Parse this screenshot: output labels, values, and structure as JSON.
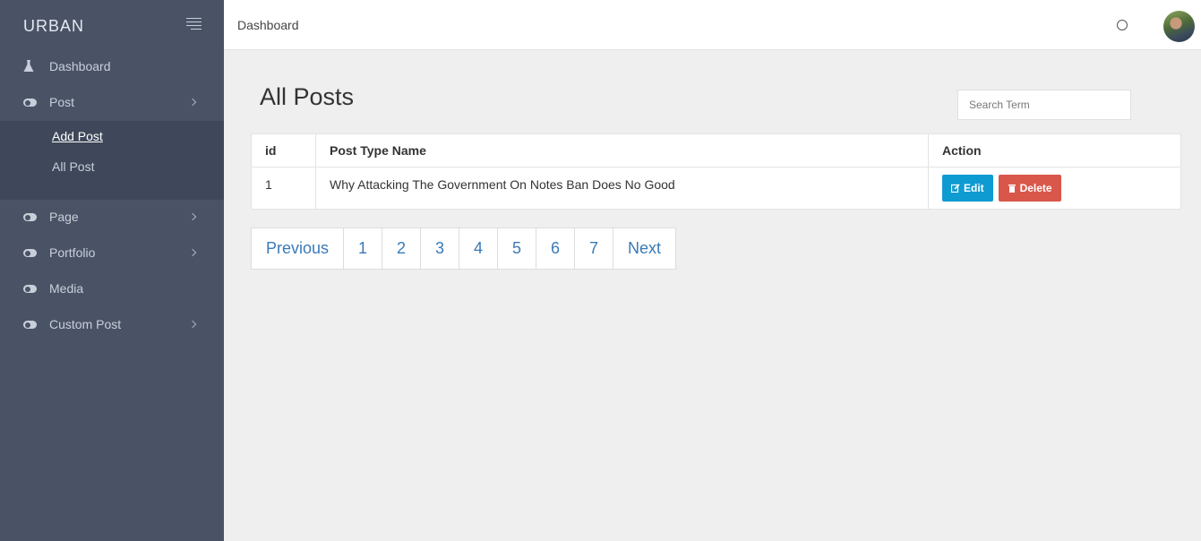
{
  "brand": {
    "name": "URBAN"
  },
  "sidebar": {
    "items": [
      {
        "label": "Dashboard",
        "icon": "flask-icon"
      },
      {
        "label": "Post",
        "icon": "toggle-icon",
        "has_submenu": true
      },
      {
        "label": "Page",
        "icon": "toggle-icon",
        "has_submenu": true
      },
      {
        "label": "Portfolio",
        "icon": "toggle-icon",
        "has_submenu": true
      },
      {
        "label": "Media",
        "icon": "toggle-icon",
        "has_submenu": false
      },
      {
        "label": "Custom Post",
        "icon": "toggle-icon",
        "has_submenu": true
      }
    ],
    "post_submenu": [
      {
        "label": "Add Post",
        "active": true
      },
      {
        "label": "All Post",
        "active": false
      }
    ]
  },
  "topbar": {
    "title": "Dashboard"
  },
  "main": {
    "title": "All Posts",
    "search": {
      "placeholder": "Search Term",
      "value": ""
    },
    "table": {
      "headers": [
        "id",
        "Post Type Name",
        "Action"
      ],
      "rows": [
        {
          "id": "1",
          "name": "Why Attacking The Government On Notes Ban Does No Good"
        }
      ],
      "edit_label": "Edit",
      "delete_label": "Delete"
    },
    "pagination": {
      "previous": "Previous",
      "pages": [
        "1",
        "2",
        "3",
        "4",
        "5",
        "6",
        "7"
      ],
      "next": "Next"
    }
  },
  "colors": {
    "sidebar_bg": "#4a5366",
    "submenu_bg": "#3f485a",
    "edit_button": "#0e9bd1",
    "delete_button": "#d9574a",
    "link": "#3a7ab8"
  }
}
